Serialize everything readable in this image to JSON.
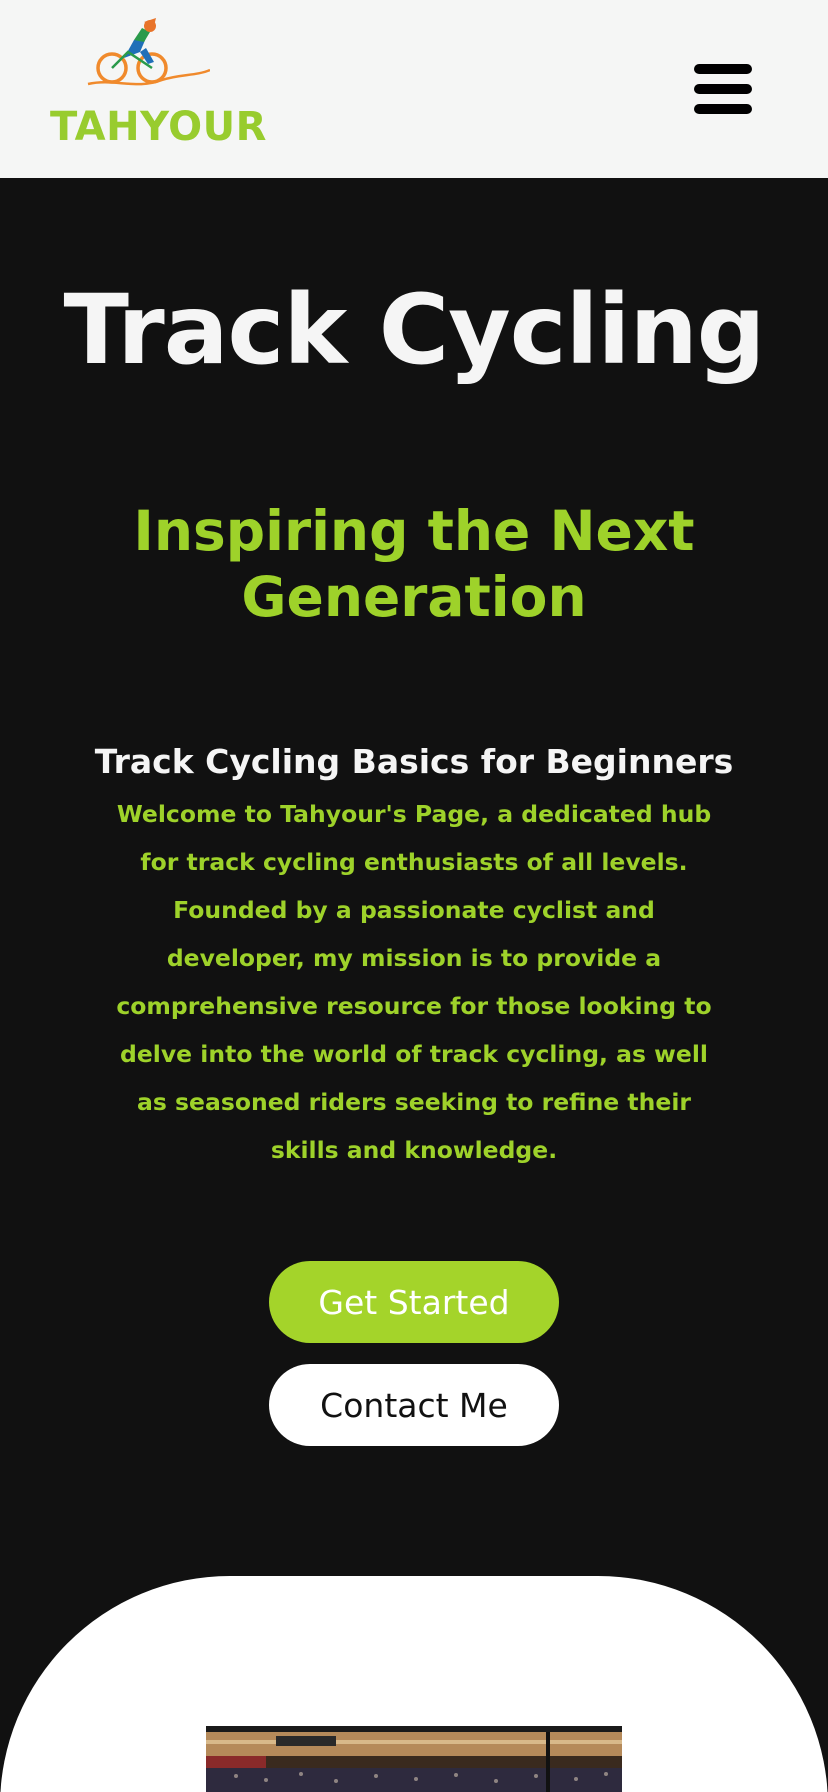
{
  "header": {
    "brand": "TAHYOUR",
    "logo_icon": "cyclist-logo-icon",
    "menu_icon": "hamburger-menu-icon"
  },
  "hero": {
    "title": "Track Cycling",
    "subtitle": "Inspiring the Next Generation"
  },
  "intro": {
    "heading": "Track Cycling Basics for Beginners",
    "body": "Welcome to Tahyour's Page, a dedicated hub for track cycling enthusiasts of all levels. Founded by a passionate cyclist and developer, my mission is to provide a comprehensive resource for those looking to delve into the world of track cycling, as well as seasoned riders seeking to refine their skills and knowledge."
  },
  "actions": {
    "get_started": "Get Started",
    "contact": "Contact Me"
  },
  "colors": {
    "accent": "#9ed22a",
    "background": "#111111",
    "header_bg": "#f5f6f5"
  }
}
